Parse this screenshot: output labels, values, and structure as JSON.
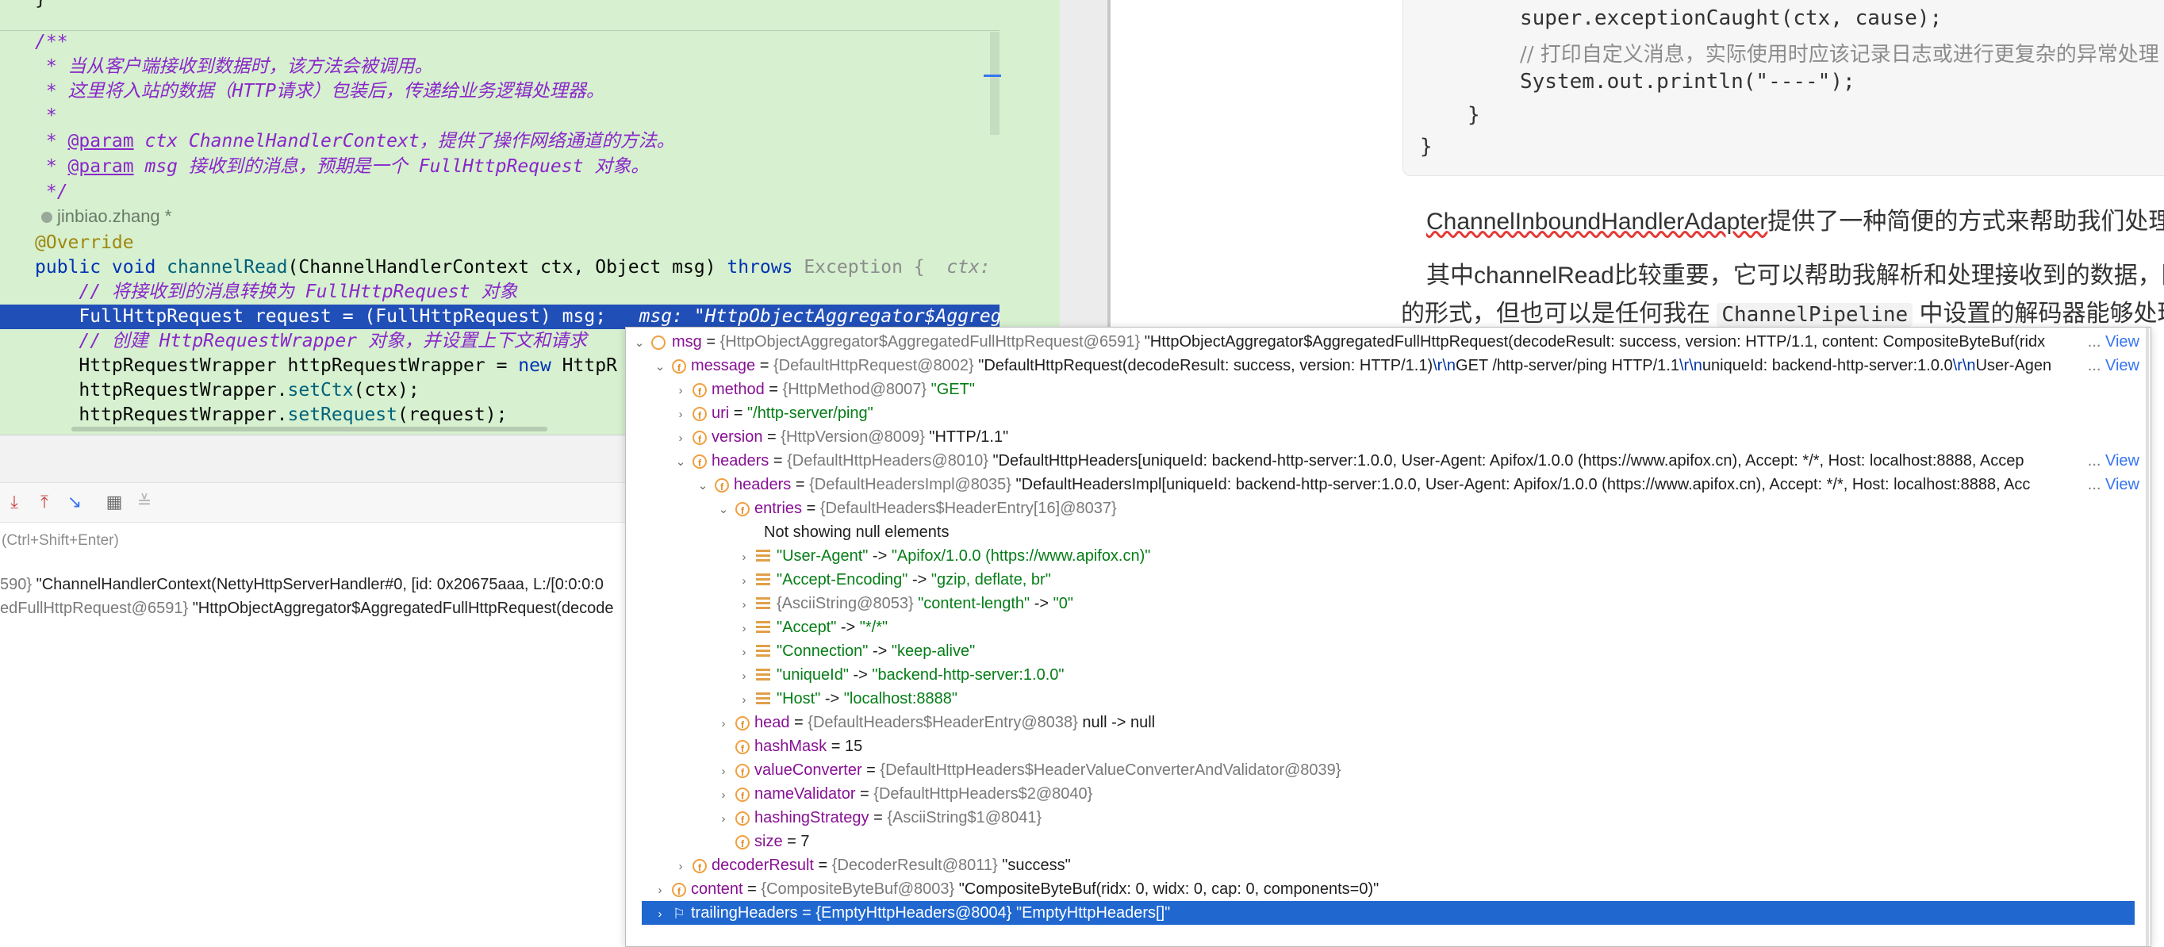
{
  "editor": {
    "lines": {
      "l1": "/**",
      "l2": " * 当从客户端接收到数据时，该方法会被调用。",
      "l3": " * 这里将入站的数据（HTTP请求）包装后，传递给业务逻辑处理器。",
      "l4": " *",
      "l5_a": " * ",
      "l5_tag": "@param",
      "l5_b": " ctx ChannelHandlerContext，提供了操作网络通道的方法。",
      "l6_a": " * ",
      "l6_tag": "@param",
      "l6_b": " msg 接收到的消息，预期是一个 FullHttpRequest 对象。",
      "l7": " */",
      "author": "jinbiao.zhang *",
      "ann": "@Override",
      "sig_kw1": "public void ",
      "sig_method": "channelRead",
      "sig_params": "(ChannelHandlerContext ctx, Object msg) ",
      "sig_throws": "throws ",
      "sig_exc": "Exception {",
      "sig_hint": "  ctx:",
      "cmt1": "    // 将接收到的消息转换为 FullHttpRequest 对象",
      "hl_code": "    FullHttpRequest request = (FullHttpRequest) msg;",
      "hl_hint": "   msg: \"HttpObjectAggregator$Aggregat",
      "cmt2": "    // 创建 HttpRequestWrapper 对象，并设置上下文和请求",
      "line_w1": "    HttpRequestWrapper httpRequestWrapper = ",
      "line_w1_kw": "new",
      "line_w1_b": " HttpR",
      "line_w2_a": "    httpRequestWrapper.",
      "line_w2_m": "setCtx",
      "line_w2_b": "(ctx);",
      "line_w3_a": "    httpRequestWrapper.",
      "line_w3_m": "setRequest",
      "line_w3_b": "(request);"
    }
  },
  "doc": {
    "code": {
      "c1": "super.exceptionCaught(ctx, cause);",
      "c2_prefix": "// ",
      "c2_comment": "打印自定义消息，实际使用时应该记录日志或进行更复杂的异常处理",
      "c3": "System.out.println(\"----\");",
      "c4": "}",
      "c5": "}"
    },
    "para1_link": "ChannelInboundHandlerAdapter",
    "para1_rest": "提供了一种简便的方式来帮助我们处理",
    "para2": "其中channelRead比较重要，它可以帮助我解析和处理接收到的数据，因为",
    "para3_a": "的形式，但也可以是任何我在 ",
    "para3_code": "ChannelPipeline",
    "para3_b": " 中设置的解码器能够处理的"
  },
  "debug": {
    "eval_placeholder": "(Ctrl+Shift+Enter)",
    "var1_id": "590} ",
    "var1_val": "\"ChannelHandlerContext(NettyHttpServerHandler#0, [id: 0x20675aaa, L:/[0:0:0:0",
    "var2_id": "edFullHttpRequest@6591} ",
    "var2_val": "\"HttpObjectAggregator$AggregatedFullHttpRequest(decode"
  },
  "tree": {
    "view_label": "View",
    "rows": {
      "msg": {
        "name": "msg",
        "type": "{HttpObjectAggregator$AggregatedFullHttpRequest@6591}",
        "value": "\"HttpObjectAggregator$AggregatedFullHttpRequest(decodeResult: success, version: HTTP/1.1, content: CompositeByteBuf(ridx"
      },
      "message": {
        "name": "message",
        "type": "{DefaultHttpRequest@8002}",
        "v1": "\"DefaultHttpRequest(decodeResult: success, version: HTTP/1.1)",
        "e1": "\\r\\n",
        "v2": "GET /http-server/ping HTTP/1.1",
        "e2": "\\r\\n",
        "v3": "uniqueId: backend-http-server:1.0.0",
        "e3": "\\r\\n",
        "v4": "User-Agen"
      },
      "method": {
        "name": "method",
        "type": "{HttpMethod@8007}",
        "value": "\"GET\""
      },
      "uri": {
        "name": "uri",
        "eq": " = ",
        "value": "\"/http-server/ping\""
      },
      "version": {
        "name": "version",
        "type": "{HttpVersion@8009}",
        "value": "\"HTTP/1.1\""
      },
      "headers": {
        "name": "headers",
        "type": "{DefaultHttpHeaders@8010}",
        "value": "\"DefaultHttpHeaders[uniqueId: backend-http-server:1.0.0, User-Agent: Apifox/1.0.0 (https://www.apifox.cn), Accept: */*, Host: localhost:8888, Accep"
      },
      "headers2": {
        "name": "headers",
        "type": "{DefaultHeadersImpl@8035}",
        "value": "\"DefaultHeadersImpl[uniqueId: backend-http-server:1.0.0, User-Agent: Apifox/1.0.0 (https://www.apifox.cn), Accept: */*, Host: localhost:8888, Acc"
      },
      "entries": {
        "name": "entries",
        "type": "{DefaultHeaders$HeaderEntry[16]@8037}"
      },
      "notnull": "Not showing null elements",
      "e1": {
        "k": "\"User-Agent\"",
        "arrow": " -> ",
        "v": "\"Apifox/1.0.0 (https://www.apifox.cn)\""
      },
      "e2": {
        "k": "\"Accept-Encoding\"",
        "arrow": " -> ",
        "v": "\"gzip, deflate, br\""
      },
      "e3": {
        "t": "{AsciiString@8053}",
        "k": " \"content-length\"",
        "arrow": " -> ",
        "v": "\"0\""
      },
      "e4": {
        "k": "\"Accept\"",
        "arrow": " -> ",
        "v": "\"*/*\""
      },
      "e5": {
        "k": "\"Connection\"",
        "arrow": " -> ",
        "v": "\"keep-alive\""
      },
      "e6": {
        "k": "\"uniqueId\"",
        "arrow": " -> ",
        "v": "\"backend-http-server:1.0.0\""
      },
      "e7": {
        "k": "\"Host\"",
        "arrow": " -> ",
        "v": "\"localhost:8888\""
      },
      "head": {
        "name": "head",
        "type": "{DefaultHeaders$HeaderEntry@8038}",
        "value": "null -> null"
      },
      "hashMask": {
        "name": "hashMask",
        "value": "15"
      },
      "valueConverter": {
        "name": "valueConverter",
        "type": "{DefaultHttpHeaders$HeaderValueConverterAndValidator@8039}"
      },
      "nameValidator": {
        "name": "nameValidator",
        "type": "{DefaultHttpHeaders$2@8040}"
      },
      "hashingStrategy": {
        "name": "hashingStrategy",
        "type": "{AsciiString$1@8041}"
      },
      "size": {
        "name": "size",
        "value": "7"
      },
      "decoderResult": {
        "name": "decoderResult",
        "type": "{DecoderResult@8011}",
        "value": "\"success\""
      },
      "content": {
        "name": "content",
        "type": "{CompositeByteBuf@8003}",
        "value": "\"CompositeByteBuf(ridx: 0, widx: 0, cap: 0, components=0)\""
      },
      "trailing": {
        "name": "trailingHeaders",
        "eq": " = ",
        "type": "{EmptyHttpHeaders@8004}",
        "value": "\"EmptyHttpHeaders[]\""
      }
    }
  },
  "colors": {
    "editor_bg": "#d6f0d0",
    "highlight": "#214fb8",
    "selection": "#2068d0",
    "link": "#3574f0"
  }
}
